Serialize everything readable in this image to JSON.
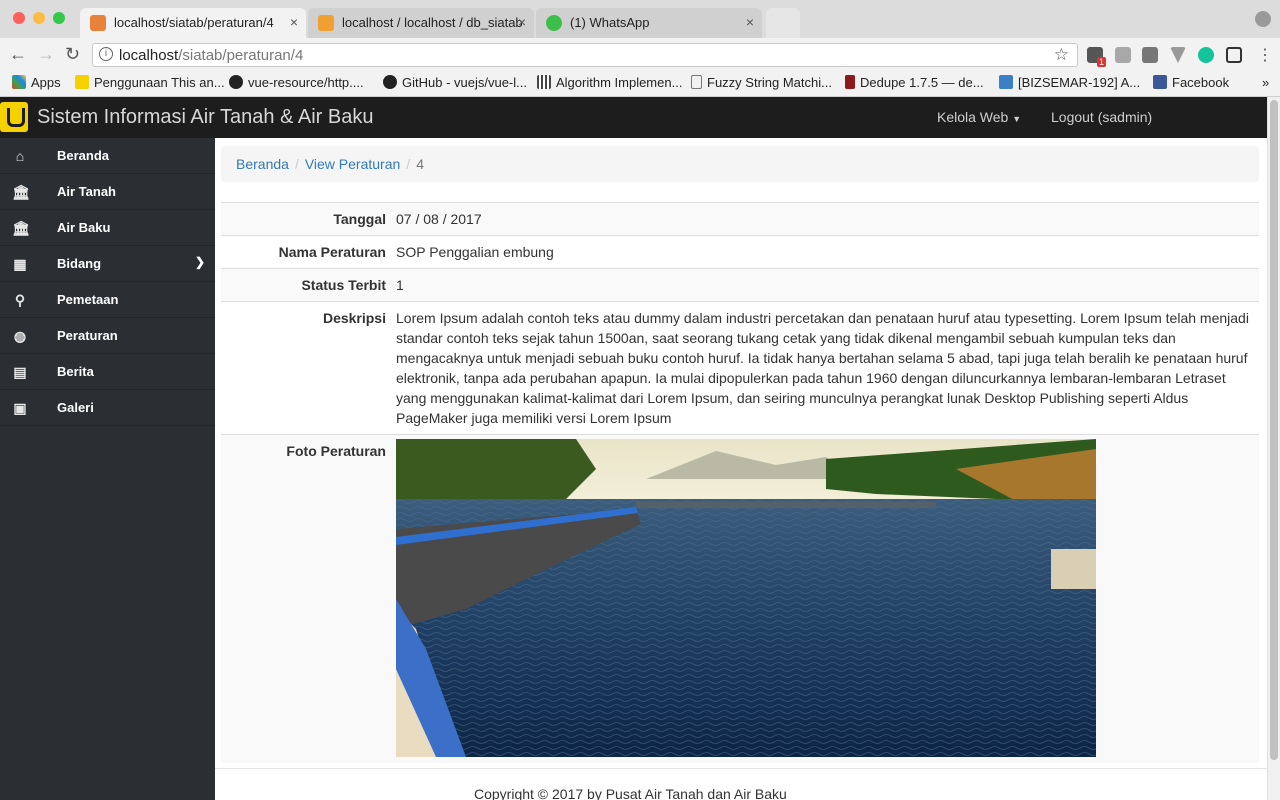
{
  "browser": {
    "tabs": [
      {
        "title": "localhost/siatab/peraturan/4",
        "active": true
      },
      {
        "title": "localhost / localhost / db_siatab",
        "active": false
      },
      {
        "title": "(1) WhatsApp",
        "active": false
      }
    ],
    "url": {
      "host": "localhost",
      "path": "/siatab/peraturan/4"
    },
    "bookmarks": [
      "Apps",
      "Penggunaan This an...",
      "vue-resource/http....",
      "GitHub - vuejs/vue-l...",
      "Algorithm Implemen...",
      "Fuzzy String Matchi...",
      "Dedupe 1.7.5 — de...",
      "[BIZSEMAR-192] A...",
      "Facebook"
    ],
    "extension_badge": "1",
    "overflow_glyph": "»"
  },
  "app": {
    "brand": "Sistem Informasi Air Tanah & Air Baku",
    "nav_manage": "Kelola Web",
    "nav_logout": "Logout (sadmin)"
  },
  "sidebar": {
    "items": [
      {
        "label": "Beranda",
        "icon": "home-icon"
      },
      {
        "label": "Air Tanah",
        "icon": "bank-icon"
      },
      {
        "label": "Air Baku",
        "icon": "bank-icon"
      },
      {
        "label": "Bidang",
        "icon": "building-icon"
      },
      {
        "label": "Pemetaan",
        "icon": "map-marker-icon"
      },
      {
        "label": "Peraturan",
        "icon": "globe-icon"
      },
      {
        "label": "Berita",
        "icon": "newspaper-icon"
      },
      {
        "label": "Galeri",
        "icon": "image-icon"
      }
    ]
  },
  "breadcrumb": {
    "home": "Beranda",
    "section": "View Peraturan",
    "current": "4"
  },
  "detail": {
    "tanggal_label": "Tanggal",
    "tanggal_value": "07 / 08 / 2017",
    "nama_label": "Nama Peraturan",
    "nama_value": "SOP Penggalian embung",
    "status_label": "Status Terbit",
    "status_value": "1",
    "deskripsi_label": "Deskripsi",
    "deskripsi_value": "Lorem Ipsum adalah contoh teks atau dummy dalam industri percetakan dan penataan huruf atau typesetting. Lorem Ipsum telah menjadi standar contoh teks sejak tahun 1500an, saat seorang tukang cetak yang tidak dikenal mengambil sebuah kumpulan teks dan mengacaknya untuk menjadi sebuah buku contoh huruf. Ia tidak hanya bertahan selama 5 abad, tapi juga telah beralih ke penataan huruf elektronik, tanpa ada perubahan apapun. Ia mulai dipopulerkan pada tahun 1960 dengan diluncurkannya lembaran-lembaran Letraset yang menggunakan kalimat-kalimat dari Lorem Ipsum, dan seiring munculnya perangkat lunak Desktop Publishing seperti Aldus PageMaker juga memiliki versi Lorem Ipsum",
    "foto_label": "Foto Peraturan"
  },
  "footer": "Copyright © 2017 by Pusat Air Tanah dan Air Baku",
  "colors": {
    "appbar": "#1d1d1d",
    "sidebar": "#2b2f33",
    "link": "#337ab7",
    "logo": "#f5d100"
  }
}
